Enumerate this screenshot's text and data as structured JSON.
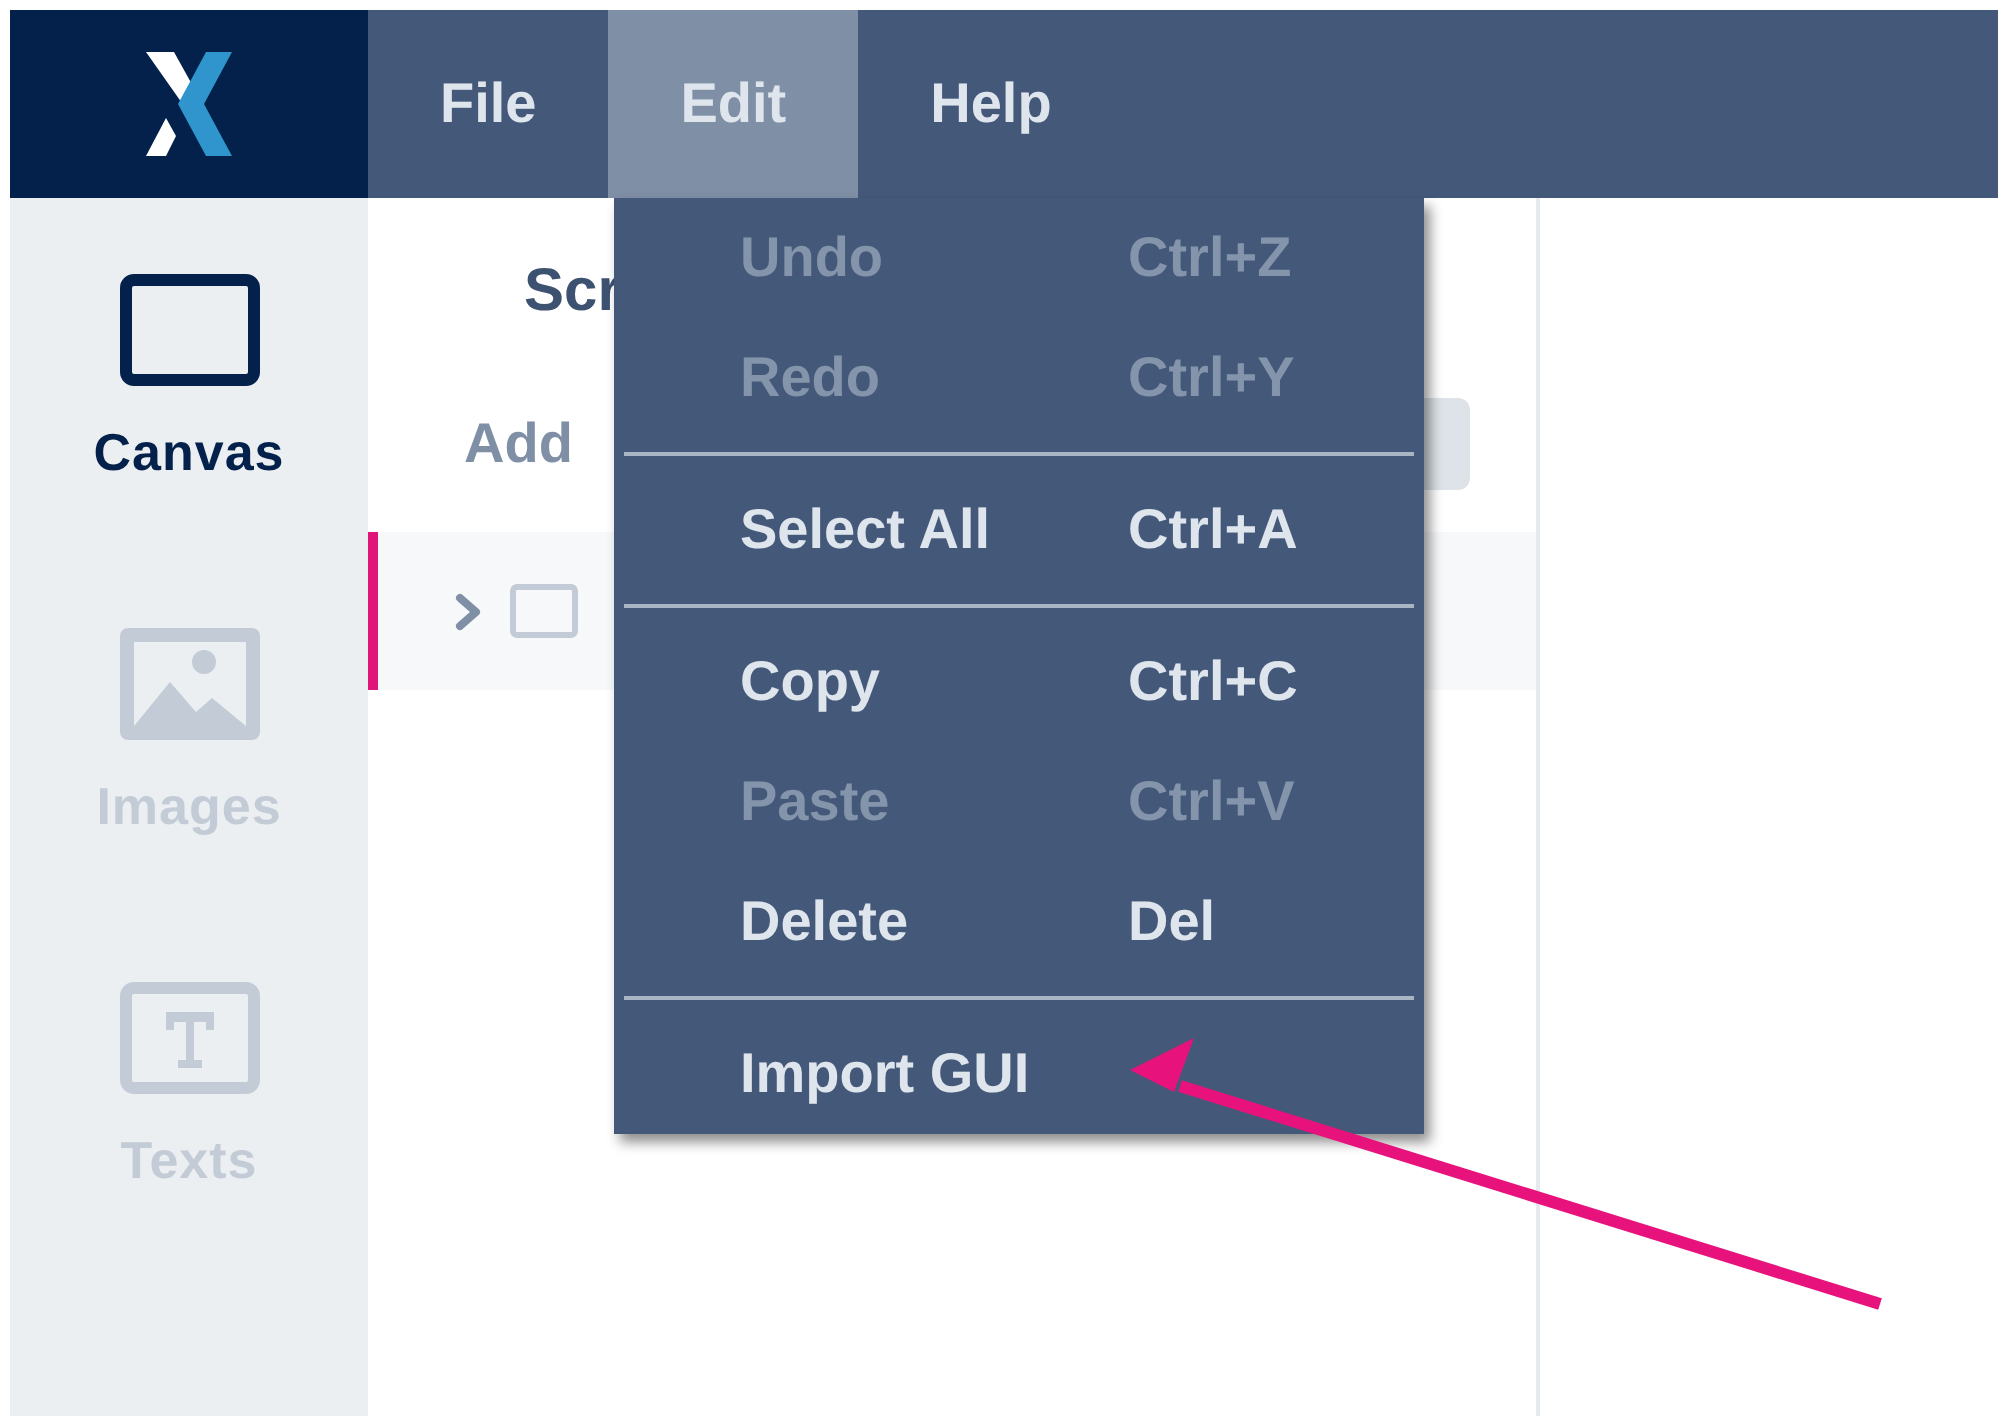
{
  "menubar": [
    {
      "label": "File",
      "selected": false
    },
    {
      "label": "Edit",
      "selected": true
    },
    {
      "label": "Help",
      "selected": false
    }
  ],
  "rail": [
    {
      "label": "Canvas",
      "kind": "canvas",
      "selected": true
    },
    {
      "label": "Images",
      "kind": "images",
      "selected": false
    },
    {
      "label": "Texts",
      "kind": "texts",
      "selected": false
    }
  ],
  "panel": {
    "heading": "Scr",
    "add_label": "Add",
    "rows": [
      {
        "selected": true,
        "expanded": false
      }
    ]
  },
  "edit_menu": [
    {
      "kind": "item",
      "label": "Undo",
      "shortcut": "Ctrl+Z",
      "disabled": true
    },
    {
      "kind": "item",
      "label": "Redo",
      "shortcut": "Ctrl+Y",
      "disabled": true
    },
    {
      "kind": "separator"
    },
    {
      "kind": "item",
      "label": "Select All",
      "shortcut": "Ctrl+A",
      "disabled": false
    },
    {
      "kind": "separator"
    },
    {
      "kind": "item",
      "label": "Copy",
      "shortcut": "Ctrl+C",
      "disabled": false
    },
    {
      "kind": "item",
      "label": "Paste",
      "shortcut": "Ctrl+V",
      "disabled": true
    },
    {
      "kind": "item",
      "label": "Delete",
      "shortcut": "Del",
      "disabled": false
    },
    {
      "kind": "separator"
    },
    {
      "kind": "item",
      "label": "Import GUI",
      "disabled": false
    }
  ]
}
